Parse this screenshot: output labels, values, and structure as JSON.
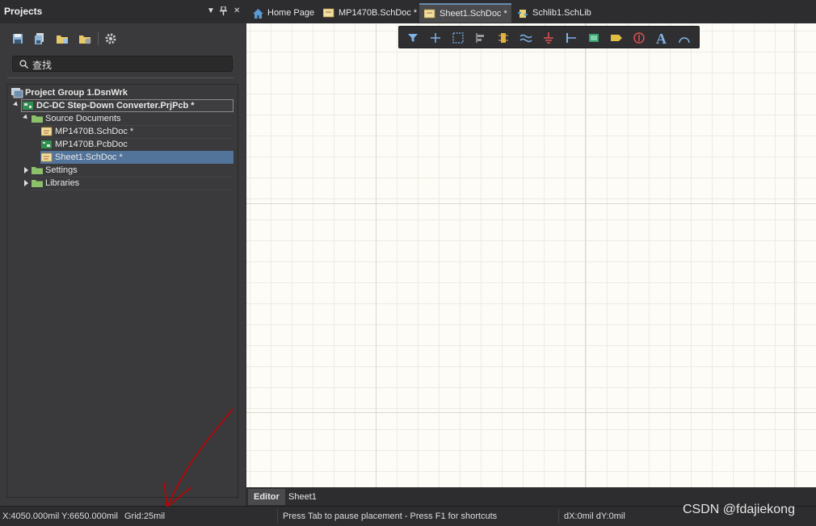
{
  "panel": {
    "title": "Projects",
    "menu_glyph": "▼",
    "pin_glyph": "📌",
    "close_glyph": "✕",
    "toolbar": [
      "save-icon",
      "save-all-icon",
      "open-folder-icon",
      "close-folder-icon",
      "settings-gear-icon"
    ],
    "search_placeholder": "查找"
  },
  "tree": {
    "group": "Project Group 1.DsnWrk",
    "project": "DC-DC Step-Down Converter.PrjPcb *",
    "source_folder": "Source Documents",
    "documents": [
      "MP1470B.SchDoc *",
      "MP1470B.PcbDoc",
      "Sheet1.SchDoc *"
    ],
    "settings_folder": "Settings",
    "libraries_folder": "Libraries"
  },
  "tabs": [
    "Home Page",
    "MP1470B.SchDoc *",
    "Sheet1.SchDoc *",
    "Schlib1.SchLib"
  ],
  "active_bar": [
    "filter-icon",
    "crosshair-icon",
    "select-rect-icon",
    "align-icon",
    "component-icon",
    "wire-icon",
    "ground-icon",
    "bus-icon",
    "harness-icon",
    "port-icon",
    "no-erc-icon",
    "text-icon",
    "arc-icon"
  ],
  "sheet_tabs": [
    "Editor",
    "Sheet1"
  ],
  "status": {
    "coords": "X:4050.000mil Y:6650.000mil",
    "grid": "Grid:25mil",
    "message": "Press Tab to pause placement - Press F1 for shortcuts",
    "delta": "dX:0mil dY:0mil"
  },
  "watermark": "CSDN @fdajiekong",
  "colors": {
    "selection": "#52739a",
    "canvas": "#fdfcf6",
    "annotation": "#c00000"
  }
}
